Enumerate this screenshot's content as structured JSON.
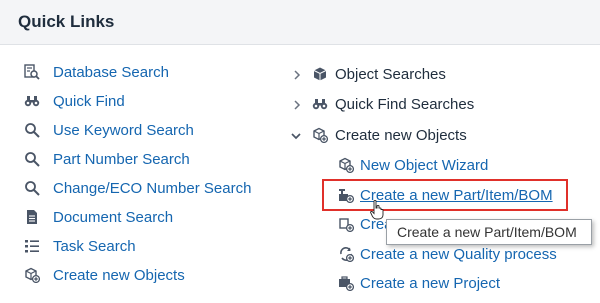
{
  "header": {
    "title": "Quick Links"
  },
  "left_items": [
    {
      "label": "Database Search",
      "icon": "database-search-icon"
    },
    {
      "label": "Quick Find",
      "icon": "binoculars-icon"
    },
    {
      "label": "Use Keyword Search",
      "icon": "magnifier-icon"
    },
    {
      "label": "Part Number Search",
      "icon": "magnifier-icon"
    },
    {
      "label": "Change/ECO Number Search",
      "icon": "magnifier-icon"
    },
    {
      "label": "Document Search",
      "icon": "document-icon"
    },
    {
      "label": "Task Search",
      "icon": "task-list-icon"
    },
    {
      "label": "Create new Objects",
      "icon": "create-objects-icon"
    }
  ],
  "right_groups": [
    {
      "label": "Object Searches",
      "icon": "cube-icon",
      "expanded": false
    },
    {
      "label": "Quick Find Searches",
      "icon": "binoculars-icon",
      "expanded": false
    },
    {
      "label": "Create new Objects",
      "icon": "create-objects-icon",
      "expanded": true
    }
  ],
  "right_children": [
    {
      "label": "New Object Wizard",
      "icon": "wizard-icon"
    },
    {
      "label": "Create a new Part/Item/BOM",
      "icon": "part-create-icon"
    },
    {
      "label": "Crea",
      "icon": "create-icon"
    },
    {
      "label": "Create a new Quality process",
      "icon": "quality-process-icon"
    },
    {
      "label": "Create a new Project",
      "icon": "project-create-icon"
    }
  ],
  "tooltip": {
    "text": "Create a new Part/Item/BOM"
  },
  "colors": {
    "link": "#1566b0",
    "highlight": "#e0302a",
    "header_bg": "#f4f5f7"
  }
}
